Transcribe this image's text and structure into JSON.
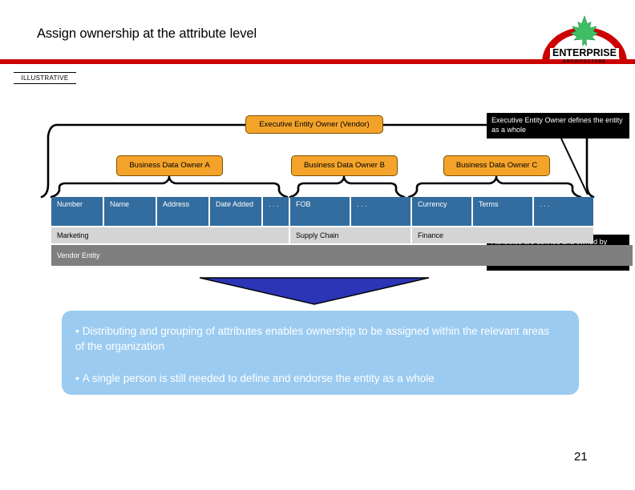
{
  "slide": {
    "title": "Assign ownership at the attribute level",
    "illustrative_tag": "ILLUSTRATIVE",
    "page_number": "21",
    "accent_red": "#cc0000",
    "accent_orange": "#f4a32a",
    "accent_blue_cell": "#336c9e",
    "accent_blue_panel": "#9bcbf0",
    "accent_arrow": "#2b35b5"
  },
  "logo": {
    "name": "ENTERPRISE",
    "subname": "A R C H I T E C T U R E",
    "leaf_color": "#3fbf63",
    "arc_color": "#cc0000"
  },
  "diagram": {
    "executive_box": "Executive Entity Owner (Vendor)",
    "business_owners": [
      "Business Data Owner A",
      "Business Data Owner B",
      "Business Data Owner C"
    ],
    "callouts": [
      "Executive Entity Owner defines the entity as a whole",
      "Attributes are defined and owned by different business areas"
    ],
    "attributes": [
      "Number",
      "Name",
      "Address",
      "Date Added",
      ". . .",
      "FOB",
      ". . .",
      "Currency",
      "Terms",
      ". . ."
    ],
    "business_areas": [
      "Marketing",
      "Supply Chain",
      "Finance"
    ],
    "entity_label": "Vendor Entity"
  },
  "summary": {
    "bullet_char": "•",
    "bullets": [
      "Distributing and grouping of attributes enables ownership to be assigned within the relevant areas of the organization",
      "A single person is still needed to define and endorse the entity as a whole"
    ]
  }
}
